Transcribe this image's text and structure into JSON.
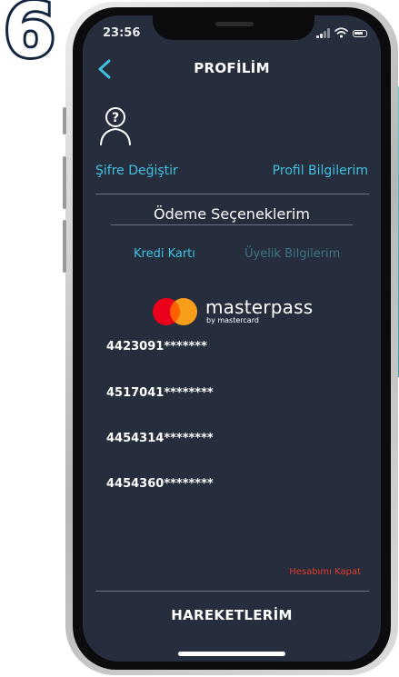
{
  "step_number": "6",
  "status_bar": {
    "time": "23:56"
  },
  "header": {
    "title": "PROFİLİM",
    "back_icon": "chevron-left-icon"
  },
  "profile": {
    "avatar_icon": "user-question-icon",
    "change_password": "Şifre Değiştir",
    "profile_info": "Profil Bilgilerim"
  },
  "payment": {
    "section_title": "Ödeme Seçeneklerim",
    "tabs": [
      {
        "label": "Kredi Kartı",
        "active": true
      },
      {
        "label": "Üyelik Bilgilerim",
        "active": false
      }
    ],
    "masterpass": {
      "brand": "masterpass",
      "subtitle": "by mastercard"
    },
    "cards": [
      "4423091*******",
      "4517041********",
      "4454314********",
      "4454360********"
    ]
  },
  "footer": {
    "close_account": "Hesabımı Kapat",
    "nav_label": "HAREKETLERİM"
  },
  "colors": {
    "screen_bg": "#262d3c",
    "accent": "#3fc0e0",
    "inactive_tab": "#3f7386",
    "danger": "#e53b2f",
    "step_outline": "#14253f"
  }
}
